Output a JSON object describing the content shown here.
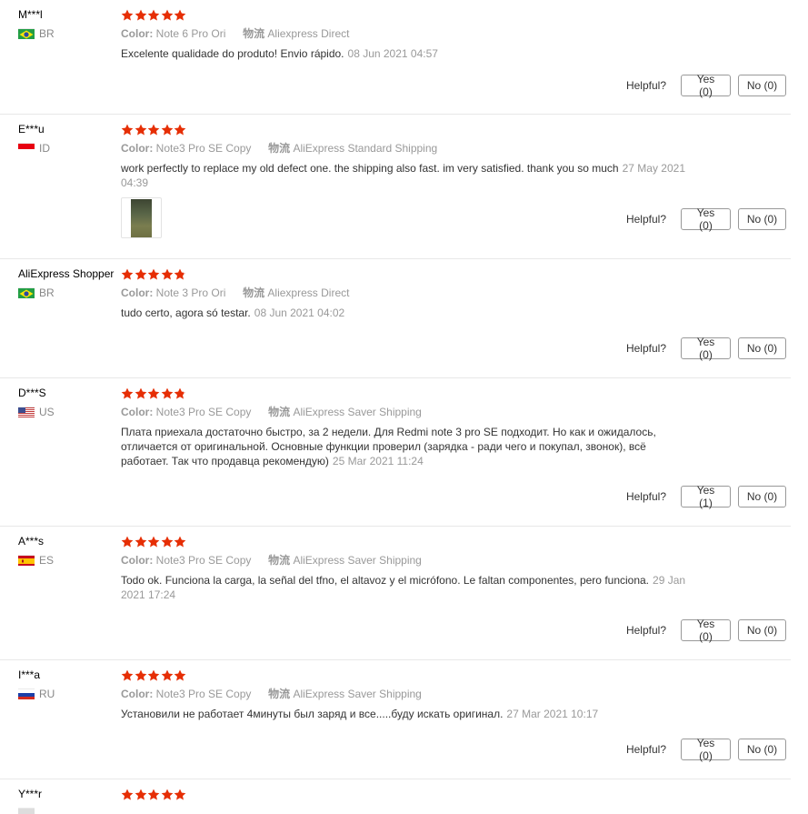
{
  "labels": {
    "color": "Color:",
    "shipping": "物流",
    "helpful": "Helpful?"
  },
  "colors": {
    "star": "#e62e04",
    "divider": "#e8e8e8"
  },
  "reviews": [
    {
      "user": "M***l",
      "country": "BR",
      "flag": "flag-brazil-icon",
      "rating": 5,
      "color": "Note 6 Pro Ori",
      "shipping": "Aliexpress Direct",
      "text": "Excelente qualidade do produto! Envio rápido.",
      "date": "08 Jun 2021 04:57",
      "yes": "Yes (0)",
      "no": "No (0)"
    },
    {
      "user": "E***u",
      "country": "ID",
      "flag": "flag-indonesia-icon",
      "rating": 5,
      "color": "Note3 Pro SE Copy",
      "shipping": "AliExpress Standard Shipping",
      "text": "work perfectly to replace my old defect one. the shipping also fast. im very satisfied. thank you so much",
      "date": "27 May 2021 04:39",
      "yes": "Yes (0)",
      "no": "No (0)"
    },
    {
      "user": "AliExpress Shopper",
      "country": "BR",
      "flag": "flag-brazil-icon",
      "rating": 4.8,
      "color": "Note 3 Pro Ori",
      "shipping": "Aliexpress Direct",
      "text": "tudo certo, agora só testar.",
      "date": "08 Jun 2021 04:02",
      "yes": "Yes (0)",
      "no": "No (0)"
    },
    {
      "user": "D***S",
      "country": "US",
      "flag": "flag-usa-icon",
      "rating": 4.8,
      "color": "Note3 Pro SE Copy",
      "shipping": "AliExpress Saver Shipping",
      "text": "Плата приехала достаточно быстро, за 2 недели. Для Redmi note 3 pro SE подходит. Но как и ожидалось, отличается от оригинальной. Основные функции проверил (зарядка - ради чего и покупал, звонок), всё работает. Так что продавца рекомендую)",
      "date": "25 Mar 2021 11:24",
      "yes": "Yes (1)",
      "no": "No (0)"
    },
    {
      "user": "A***s",
      "country": "ES",
      "flag": "flag-spain-icon",
      "rating": 5,
      "color": "Note3 Pro SE Copy",
      "shipping": "AliExpress Saver Shipping",
      "text": "Todo ok. Funciona la carga, la señal del tfno, el altavoz y el micrófono. Le faltan componentes, pero funciona.",
      "date": "29 Jan 2021 17:24",
      "yes": "Yes (0)",
      "no": "No (0)"
    },
    {
      "user": "I***a",
      "country": "RU",
      "flag": "flag-russia-icon",
      "rating": 5,
      "color": "Note3 Pro SE Copy",
      "shipping": "AliExpress Saver Shipping",
      "text": "Установили не работает 4минуты был заряд и все.....буду искать оригинал.",
      "date": "27 Mar 2021 10:17",
      "yes": "Yes (0)",
      "no": "No (0)"
    },
    {
      "user": "Y***r",
      "country": "",
      "flag": "flag-icon",
      "rating": 5,
      "color": "",
      "shipping": "",
      "text": "",
      "date": "",
      "yes": "",
      "no": ""
    }
  ]
}
